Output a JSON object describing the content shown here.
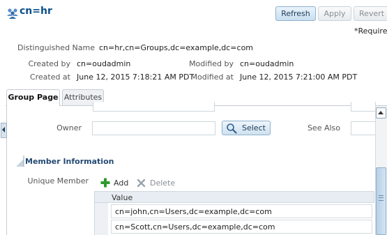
{
  "header": {
    "title": "cn=hr",
    "refresh_label": "Refresh",
    "apply_label": "Apply",
    "revert_label": "Revert",
    "required_note": "*Required"
  },
  "details": {
    "dn_label": "Distinguished Name",
    "dn_value": "cn=hr,cn=Groups,dc=example,dc=com",
    "created_by_label": "Created by",
    "created_by_value": "cn=oudadmin",
    "modified_by_label": "Modified by",
    "modified_by_value": "cn=oudadmin",
    "created_at_label": "Created at",
    "created_at_value": "June 12, 2015 7:18:21 AM PDT",
    "modified_at_label": "Modified at",
    "modified_at_value": "June 12, 2015 7:21:00 AM PDT"
  },
  "tabs": [
    {
      "label": "Group Page",
      "active": true
    },
    {
      "label": "Attributes",
      "active": false
    }
  ],
  "form": {
    "owner_label": "Owner",
    "owner_value": "",
    "select_label": "Select",
    "see_also_label": "See Also",
    "see_also_value": ""
  },
  "member_section": {
    "title": "Member Information",
    "unique_member_label": "Unique Member",
    "add_label": "Add",
    "delete_label": "Delete",
    "column_header": "Value",
    "rows": [
      "cn=john,cn=Users,dc=example,dc=com",
      "cn=Scott,cn=Users,dc=example,dc=com"
    ]
  },
  "colors": {
    "title": "#0b4f8a",
    "accent": "#8fb1cf",
    "add_icon": "#2e9a2e"
  }
}
